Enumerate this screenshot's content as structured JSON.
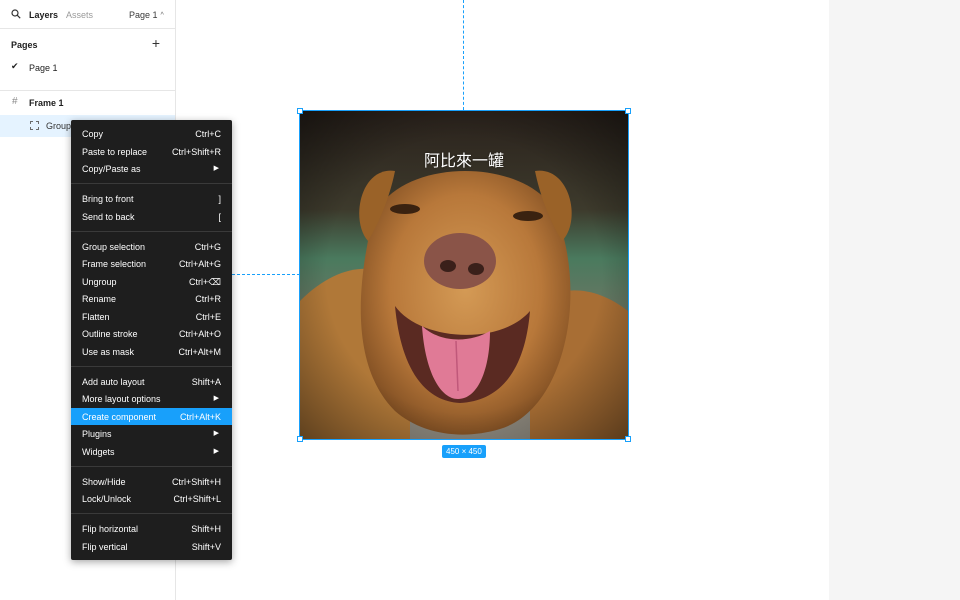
{
  "left_panel": {
    "tabs": {
      "layers": "Layers",
      "assets": "Assets"
    },
    "page_selector": "Page 1",
    "pages_title": "Pages",
    "pages": [
      {
        "label": "Page 1",
        "selected": true
      }
    ],
    "layers": [
      {
        "label": "Frame 1",
        "type": "frame"
      },
      {
        "label": "Group",
        "type": "group",
        "selected": true
      }
    ]
  },
  "canvas": {
    "image_caption": "阿比來一罐",
    "size_badge": "450 × 450",
    "selection_color": "#18a0fb"
  },
  "context_menu": {
    "groups": [
      [
        {
          "label": "Copy",
          "shortcut": "Ctrl+C"
        },
        {
          "label": "Paste to replace",
          "shortcut": "Ctrl+Shift+R"
        },
        {
          "label": "Copy/Paste as",
          "submenu": true
        }
      ],
      [
        {
          "label": "Bring to front",
          "shortcut": "]"
        },
        {
          "label": "Send to back",
          "shortcut": "["
        }
      ],
      [
        {
          "label": "Group selection",
          "shortcut": "Ctrl+G"
        },
        {
          "label": "Frame selection",
          "shortcut": "Ctrl+Alt+G"
        },
        {
          "label": "Ungroup",
          "shortcut": "Ctrl+⌫"
        },
        {
          "label": "Rename",
          "shortcut": "Ctrl+R"
        },
        {
          "label": "Flatten",
          "shortcut": "Ctrl+E"
        },
        {
          "label": "Outline stroke",
          "shortcut": "Ctrl+Alt+O"
        },
        {
          "label": "Use as mask",
          "shortcut": "Ctrl+Alt+M"
        }
      ],
      [
        {
          "label": "Add auto layout",
          "shortcut": "Shift+A"
        },
        {
          "label": "More layout options",
          "submenu": true
        },
        {
          "label": "Create component",
          "shortcut": "Ctrl+Alt+K",
          "highlighted": true
        },
        {
          "label": "Plugins",
          "submenu": true
        },
        {
          "label": "Widgets",
          "submenu": true
        }
      ],
      [
        {
          "label": "Show/Hide",
          "shortcut": "Ctrl+Shift+H"
        },
        {
          "label": "Lock/Unlock",
          "shortcut": "Ctrl+Shift+L"
        }
      ],
      [
        {
          "label": "Flip horizontal",
          "shortcut": "Shift+H"
        },
        {
          "label": "Flip vertical",
          "shortcut": "Shift+V"
        }
      ]
    ]
  }
}
